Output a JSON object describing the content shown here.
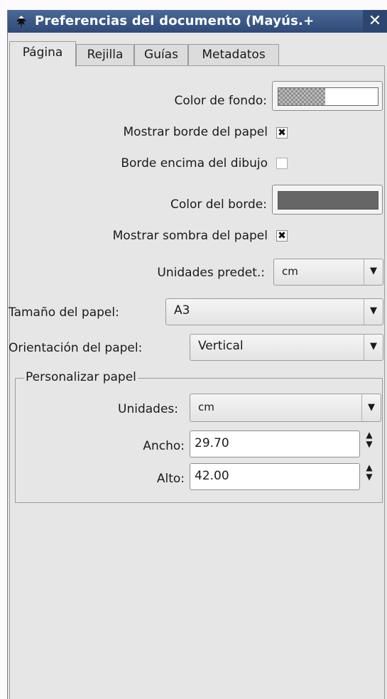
{
  "window": {
    "title": "Preferencias del documento (Mayús.+",
    "close_label": "✕"
  },
  "tabs": [
    {
      "label": "Página",
      "active": true
    },
    {
      "label": "Rejilla",
      "active": false
    },
    {
      "label": "Guías",
      "active": false
    },
    {
      "label": "Metadatos",
      "active": false
    }
  ],
  "page": {
    "bg_color_label": "Color de fondo:",
    "show_border_label": "Mostrar borde del papel",
    "show_border_checked": "✖",
    "border_on_top_label": "Borde encima del dibujo",
    "border_on_top_checked": "",
    "border_color_label": "Color del borde:",
    "border_color": "#666666",
    "show_shadow_label": "Mostrar sombra del papel",
    "show_shadow_checked": "✖",
    "default_units_label": "Unidades predet.:",
    "default_units_value": "cm",
    "paper_size_label": "Tamaño del papel:",
    "paper_size_value": "A3",
    "orientation_label": "Orientación del papel:",
    "orientation_value": "Vertical"
  },
  "custom": {
    "legend": "Personalizar papel",
    "units_label": "Unidades:",
    "units_value": "cm",
    "width_label": "Ancho:",
    "width_value": "29.70",
    "height_label": "Alto:",
    "height_value": "42.00"
  },
  "icons": {
    "dropdown": "▼",
    "spin_up": "▲",
    "spin_down": "▼"
  },
  "colors": {
    "titlebar": "#3b5584",
    "panel": "#e6e6e6"
  }
}
